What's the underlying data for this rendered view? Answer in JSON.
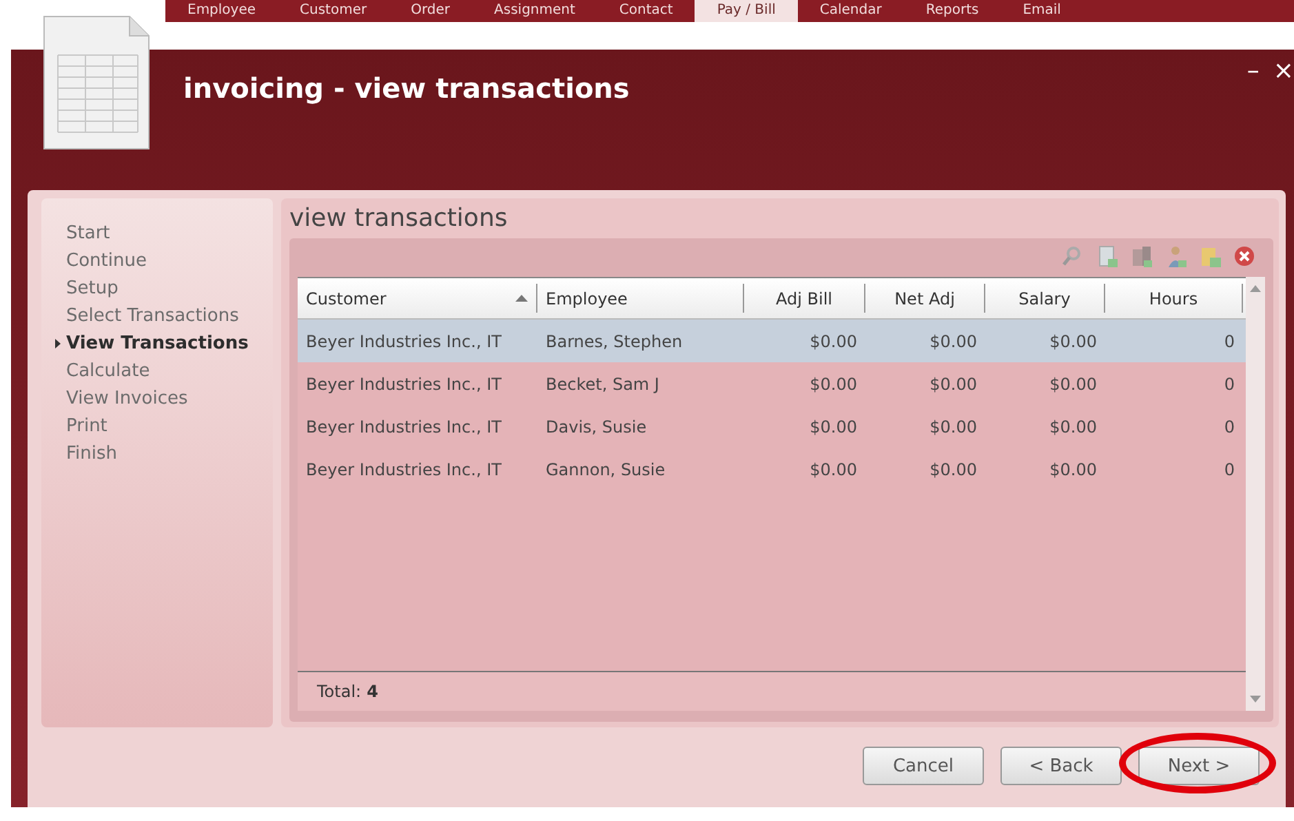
{
  "top_tabs": [
    {
      "label": "Employee",
      "selected": false
    },
    {
      "label": "Customer",
      "selected": false
    },
    {
      "label": "Order",
      "selected": false
    },
    {
      "label": "Assignment",
      "selected": false
    },
    {
      "label": "Contact",
      "selected": false
    },
    {
      "label": "Pay / Bill",
      "selected": true
    },
    {
      "label": "Calendar",
      "selected": false
    },
    {
      "label": "Reports",
      "selected": false
    },
    {
      "label": "Email",
      "selected": false
    }
  ],
  "window": {
    "title": "invoicing - view transactions",
    "minimize": "–",
    "close": "×"
  },
  "steps": [
    {
      "label": "Start",
      "selected": false
    },
    {
      "label": "Continue",
      "selected": false
    },
    {
      "label": "Setup",
      "selected": false
    },
    {
      "label": "Select Transactions",
      "selected": false
    },
    {
      "label": "View Transactions",
      "selected": true
    },
    {
      "label": "Calculate",
      "selected": false
    },
    {
      "label": "View Invoices",
      "selected": false
    },
    {
      "label": "Print",
      "selected": false
    },
    {
      "label": "Finish",
      "selected": false
    }
  ],
  "section_title": "view transactions",
  "toolbar": [
    {
      "kind": "search"
    },
    {
      "kind": "document"
    },
    {
      "kind": "building"
    },
    {
      "kind": "person"
    },
    {
      "kind": "folder"
    },
    {
      "kind": "delete"
    }
  ],
  "table": {
    "columns": [
      {
        "label": "Customer",
        "sorted": true,
        "kind": "text"
      },
      {
        "label": "Employee",
        "sorted": false,
        "kind": "text"
      },
      {
        "label": "Adj Bill",
        "sorted": false,
        "kind": "number"
      },
      {
        "label": "Net Adj",
        "sorted": false,
        "kind": "number"
      },
      {
        "label": "Salary",
        "sorted": false,
        "kind": "number"
      },
      {
        "label": "Hours",
        "sorted": false,
        "kind": "number"
      }
    ],
    "rows": [
      {
        "cells": [
          "Beyer Industries Inc., IT",
          "Barnes, Stephen",
          "$0.00",
          "$0.00",
          "$0.00",
          "0"
        ],
        "selected": true
      },
      {
        "cells": [
          "Beyer Industries Inc., IT",
          "Becket, Sam J",
          "$0.00",
          "$0.00",
          "$0.00",
          "0"
        ],
        "selected": false
      },
      {
        "cells": [
          "Beyer Industries Inc., IT",
          "Davis, Susie",
          "$0.00",
          "$0.00",
          "$0.00",
          "0"
        ],
        "selected": false
      },
      {
        "cells": [
          "Beyer Industries Inc., IT",
          "Gannon, Susie",
          "$0.00",
          "$0.00",
          "$0.00",
          "0"
        ],
        "selected": false
      }
    ],
    "total_label": "Total:",
    "total_value": "4"
  },
  "buttons": [
    {
      "label": "Cancel",
      "highlighted": false
    },
    {
      "label": "< Back",
      "highlighted": false
    },
    {
      "label": "Next >",
      "highlighted": true
    }
  ]
}
